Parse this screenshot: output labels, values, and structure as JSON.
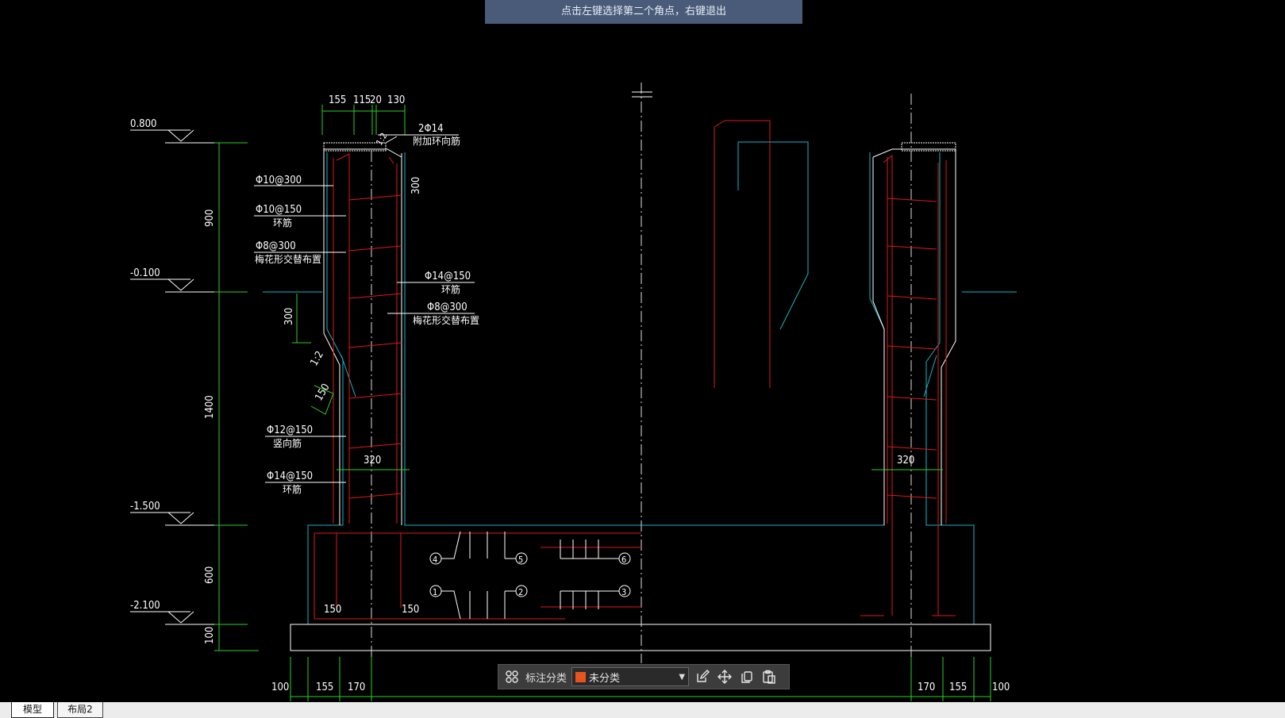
{
  "prompt": {
    "text": "点击左键选择第二个角点，右键退出"
  },
  "toolbar": {
    "label": "标注分类",
    "select_value": "未分类",
    "swatch_color": "#e8541e"
  },
  "tabs": [
    {
      "label": "模型"
    },
    {
      "label": "布局2"
    }
  ],
  "drawing": {
    "elevations": [
      "0.800",
      "-0.100",
      "-1.500",
      "-2.100"
    ],
    "left_dims": [
      "900",
      "1400",
      "600",
      "100"
    ],
    "top_dims": [
      "155",
      "115",
      "20",
      "130"
    ],
    "top_rebar": {
      "spec": "2Φ14",
      "note": "附加环向筋"
    },
    "callouts": [
      {
        "spec": "Φ10@300",
        "note": ""
      },
      {
        "spec": "Φ10@150",
        "note": "环筋"
      },
      {
        "spec": "Φ8@300",
        "note": "梅花形交替布置"
      },
      {
        "spec": "Φ14@150",
        "note": "环筋"
      },
      {
        "spec": "Φ8@300",
        "note": "梅花形交替布置"
      },
      {
        "spec": "Φ12@150",
        "note": "竖向筋"
      },
      {
        "spec": "Φ14@150",
        "note": "环筋"
      }
    ],
    "misc": {
      "h300_top": "300",
      "h300_side": "300",
      "slope": "1:2",
      "chamfer": "150",
      "slope_top": "1:2"
    },
    "wall_width": "320",
    "wall_width_right": "320",
    "base_dims": [
      "150",
      "150"
    ],
    "bottom_dims_left": [
      "100",
      "155",
      "170"
    ],
    "bottom_dims_right": [
      "170",
      "155",
      "100"
    ],
    "markers": [
      "4",
      "5",
      "6",
      "1",
      "2",
      "3"
    ]
  }
}
